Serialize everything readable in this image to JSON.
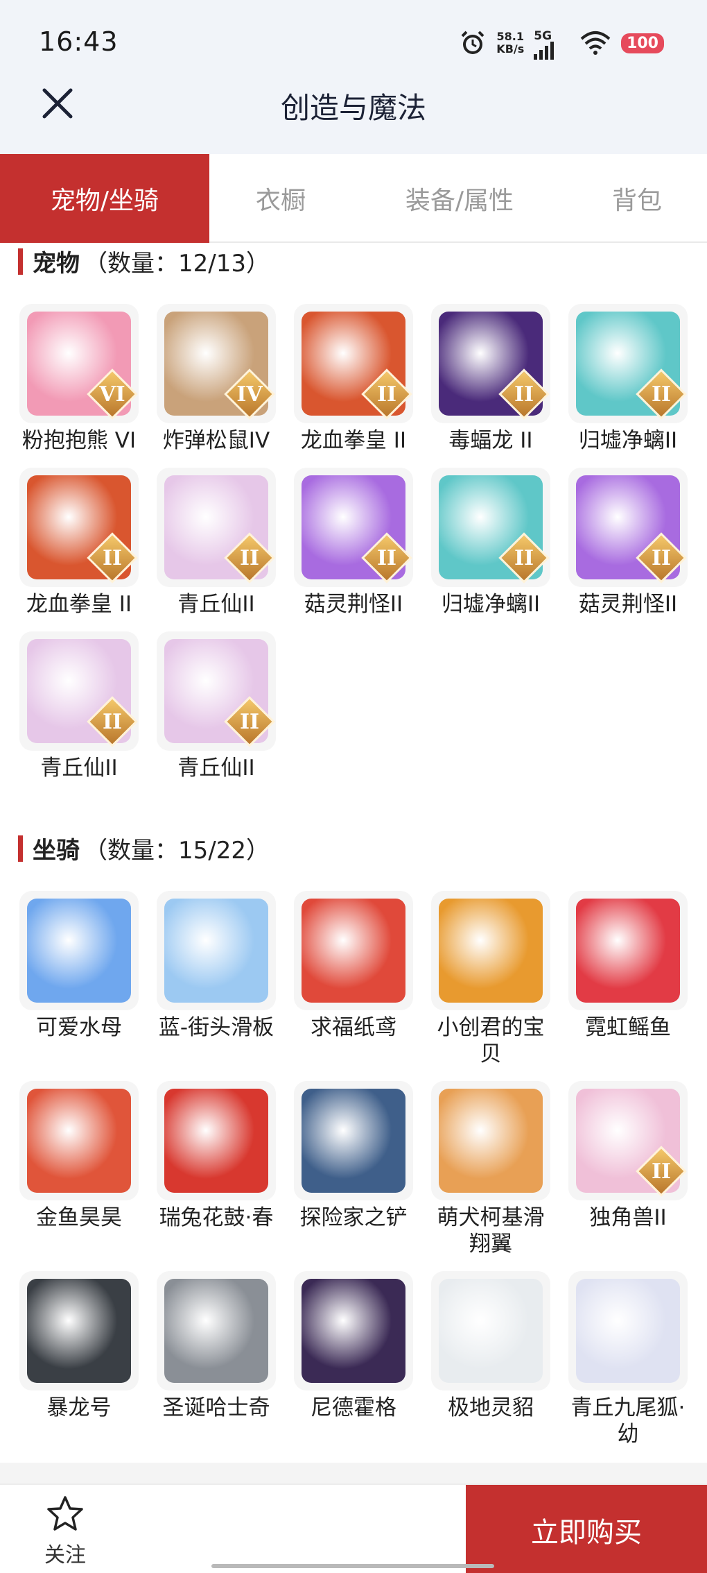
{
  "status": {
    "time": "16:43",
    "speed_top": "58.1",
    "speed_bottom": "KB/s",
    "network": "5G",
    "battery": "100"
  },
  "header": {
    "title": "创造与魔法"
  },
  "tabs": [
    {
      "label": "宠物/坐骑",
      "active": true
    },
    {
      "label": "衣橱",
      "active": false
    },
    {
      "label": "装备/属性",
      "active": false
    },
    {
      "label": "背包",
      "active": false
    }
  ],
  "pets": {
    "title": "宠物",
    "count": "（数量：12/13）",
    "items": [
      {
        "name": "粉抱抱熊 VI",
        "badge": "VI",
        "icon": "pink-bear-icon",
        "color": "#f29ab5"
      },
      {
        "name": "炸弹松鼠IV",
        "badge": "IV",
        "icon": "squirrel-icon",
        "color": "#c9a27a"
      },
      {
        "name": "龙血拳皇 II",
        "badge": "II",
        "icon": "red-ox-icon",
        "color": "#d9562f"
      },
      {
        "name": "毒蝠龙 II",
        "badge": "II",
        "icon": "bat-dragon-icon",
        "color": "#4a2a7a"
      },
      {
        "name": "归墟净螭II",
        "badge": "II",
        "icon": "cyan-dragon-icon",
        "color": "#5fc7c8"
      },
      {
        "name": "龙血拳皇 II",
        "badge": "II",
        "icon": "red-ox-icon",
        "color": "#d9562f"
      },
      {
        "name": "青丘仙II",
        "badge": "II",
        "icon": "fox-fairy-icon",
        "color": "#e6c7e8"
      },
      {
        "name": "菇灵荆怪II",
        "badge": "II",
        "icon": "mushroom-sprite-icon",
        "color": "#a86be0"
      },
      {
        "name": "归墟净螭II",
        "badge": "II",
        "icon": "cyan-dragon-icon",
        "color": "#5fc7c8"
      },
      {
        "name": "菇灵荆怪II",
        "badge": "II",
        "icon": "mushroom-sprite-icon",
        "color": "#a86be0"
      },
      {
        "name": "青丘仙II",
        "badge": "II",
        "icon": "fox-fairy-icon",
        "color": "#e6c7e8"
      },
      {
        "name": "青丘仙II",
        "badge": "II",
        "icon": "fox-fairy-icon",
        "color": "#e6c7e8"
      }
    ]
  },
  "mounts": {
    "title": "坐骑",
    "count": "（数量：15/22）",
    "items": [
      {
        "name": "可爱水母",
        "badge": "",
        "icon": "jellyfish-icon",
        "color": "#6fa7ee"
      },
      {
        "name": "蓝-街头滑板",
        "badge": "",
        "icon": "skateboard-icon",
        "color": "#9cc9f2"
      },
      {
        "name": "求福纸鸢",
        "badge": "",
        "icon": "kite-fish-icon",
        "color": "#e0493a"
      },
      {
        "name": "小创君的宝贝",
        "badge": "",
        "icon": "parrot-icon",
        "color": "#e89a2f"
      },
      {
        "name": "霓虹鳐鱼",
        "badge": "",
        "icon": "ray-fish-icon",
        "color": "#e23b45"
      },
      {
        "name": "金鱼昊昊",
        "badge": "",
        "icon": "goldfish-icon",
        "color": "#e0553a"
      },
      {
        "name": "瑞兔花鼓·春",
        "badge": "",
        "icon": "drum-icon",
        "color": "#d8382f"
      },
      {
        "name": "探险家之铲",
        "badge": "",
        "icon": "shovel-icon",
        "color": "#3f5f8a"
      },
      {
        "name": "萌犬柯基滑翔翼",
        "badge": "",
        "icon": "corgi-icon",
        "color": "#e8a055"
      },
      {
        "name": "独角兽II",
        "badge": "II",
        "icon": "unicorn-icon",
        "color": "#f0c0d8"
      },
      {
        "name": "暴龙号",
        "badge": "",
        "icon": "mecha-dino-icon",
        "color": "#3a3f45"
      },
      {
        "name": "圣诞哈士奇",
        "badge": "",
        "icon": "husky-icon",
        "color": "#8a8f96"
      },
      {
        "name": "尼德霍格",
        "badge": "",
        "icon": "dark-dragon-icon",
        "color": "#3b2a55"
      },
      {
        "name": "极地灵貂",
        "badge": "",
        "icon": "polar-weasel-icon",
        "color": "#e8ecef"
      },
      {
        "name": "青丘九尾狐·幼",
        "badge": "",
        "icon": "nine-tail-fox-icon",
        "color": "#dfe2f2"
      }
    ]
  },
  "bottom": {
    "follow_label": "关注",
    "buy_label": "立即购买"
  }
}
